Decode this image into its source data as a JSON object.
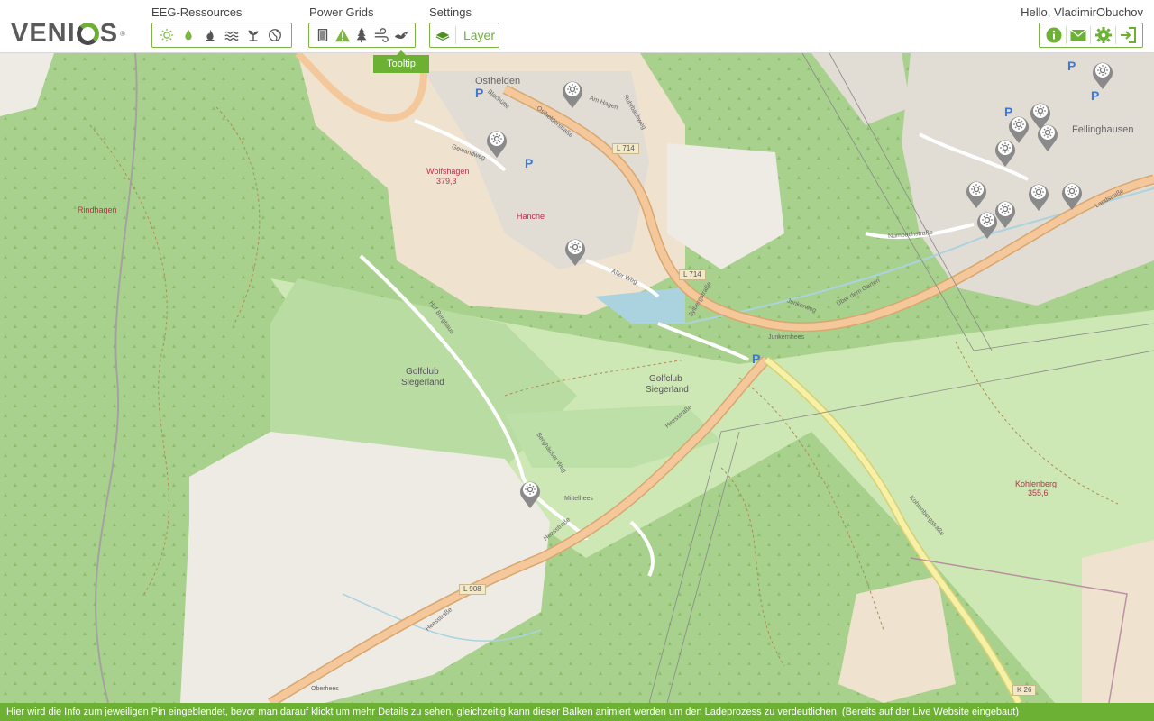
{
  "brand": {
    "name_left": "VENI",
    "name_right": "S",
    "trademark": "®"
  },
  "header": {
    "groups": [
      {
        "label": "EEG-Ressources",
        "icons": [
          "sun-icon",
          "drop-icon",
          "flame-icon",
          "waves-icon",
          "sprout-icon",
          "globe-icon"
        ]
      },
      {
        "label": "Power Grids",
        "icons": [
          "battery-icon",
          "warning-icon",
          "tree-icon",
          "wind-icon",
          "bird-icon"
        ]
      },
      {
        "label": "Settings",
        "layer_label": "Layer"
      }
    ],
    "tooltip": "Tooltip",
    "greeting": "Hello, VladimirObuchov",
    "user_buttons": [
      "info-icon",
      "mail-icon",
      "gear-icon",
      "logout-icon"
    ]
  },
  "colors": {
    "accent": "#6cb134",
    "forest": "#a9d18e",
    "meadow": "#cde8b4",
    "residential": "#e1dcd4",
    "farmland": "#eee6d4",
    "road_main": "#f4c89a",
    "road_secondary": "#f7f1a7",
    "water": "#aad3df",
    "peak": "#b8314f"
  },
  "map": {
    "places": [
      "Osthelden",
      "Fellinghausen",
      "Wolfshagen",
      "379,3",
      "Hanche",
      "Rindhagen",
      "Golfclub",
      "Siegerland",
      "Golfclub",
      "Siegerland",
      "Junkernhees",
      "Mittelhees",
      "Kohlenberg",
      "355,6",
      "Oberhees"
    ],
    "roads": [
      "Osthelderstraße",
      "L 714",
      "L 714",
      "Heesstraße",
      "Heesstraße",
      "Heesstraße",
      "L 908",
      "K 26",
      "Kohlenbergstraße",
      "Hof Berghaus",
      "Berghäuser Weg",
      "Alter Weg",
      "Sylbergstraße",
      "Junkerweg",
      "Über dem Garten",
      "Numbachstraße",
      "Landstraße",
      "Gewandweg",
      "Blachütte",
      "Am Hagen",
      "Ruhrbachweg"
    ],
    "parking": [
      "P",
      "P",
      "P",
      "P",
      "P",
      "P"
    ],
    "pin_icon": "sun-icon",
    "pins_count": 14
  },
  "footer": "Hier wird die Info zum jeweiligen Pin eingeblendet, bevor man darauf klickt um mehr Details zu sehen, gleichzeitig kann dieser Balken animiert werden um den Ladeprozess zu verdeutlichen. (Bereits auf der Live Website eingebaut)"
}
